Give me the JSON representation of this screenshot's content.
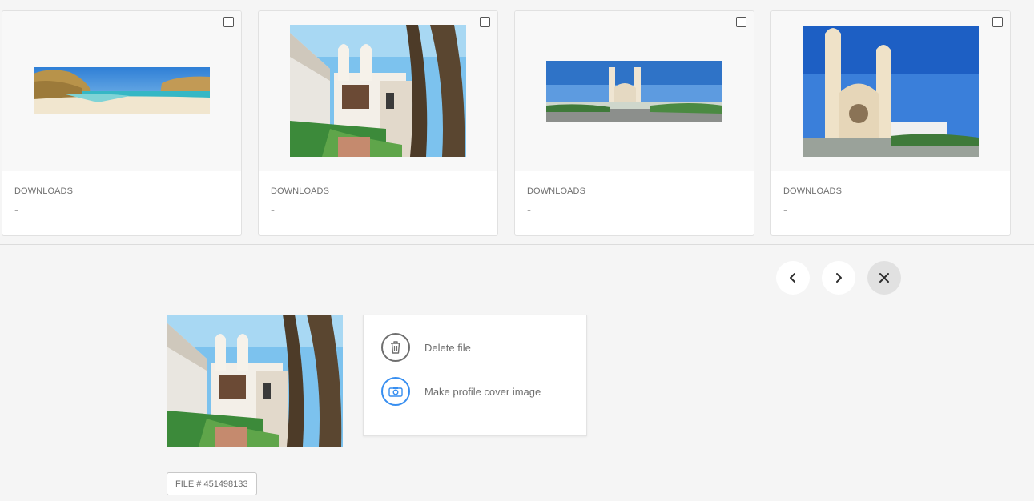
{
  "assets": [
    {
      "downloads_label": "DOWNLOADS",
      "downloads_value": "-",
      "image": "beach-panorama"
    },
    {
      "downloads_label": "DOWNLOADS",
      "downloads_value": "-",
      "image": "church-courtyard"
    },
    {
      "downloads_label": "DOWNLOADS",
      "downloads_value": "-",
      "image": "cathedral-wide-panorama"
    },
    {
      "downloads_label": "DOWNLOADS",
      "downloads_value": "-",
      "image": "cathedral-front"
    }
  ],
  "nav": {
    "prev_icon": "chevron-left-icon",
    "next_icon": "chevron-right-icon",
    "close_icon": "close-icon"
  },
  "detail": {
    "menu": [
      {
        "label": "Delete file",
        "icon": "trash-icon"
      },
      {
        "label": "Make profile cover image",
        "icon": "camera-icon"
      }
    ],
    "file_id": "FILE # 451498133"
  },
  "colors": {
    "accent": "#378ef0",
    "icon_gray": "#6e6e6e",
    "background": "#f5f5f5"
  }
}
